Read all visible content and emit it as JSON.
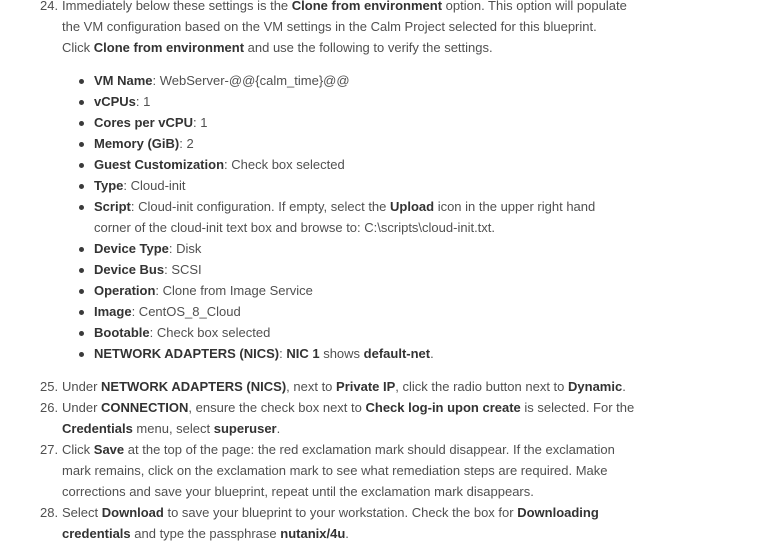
{
  "steps": [
    {
      "num": "24.",
      "lines": [
        [
          {
            "t": "Immediately below these settings is the "
          },
          {
            "b": "Clone from environment"
          },
          {
            "t": " option. This option will populate"
          }
        ],
        [
          {
            "t": "the VM configuration based on the VM settings in the Calm Project selected for this blueprint."
          }
        ],
        [
          {
            "t": "Click "
          },
          {
            "b": "Clone from environment"
          },
          {
            "t": " and use the following to verify the settings."
          }
        ]
      ]
    },
    {
      "num": "25.",
      "lines": [
        [
          {
            "t": "Under "
          },
          {
            "b": "NETWORK ADAPTERS (NICS)"
          },
          {
            "t": ", next to "
          },
          {
            "b": "Private IP"
          },
          {
            "t": ", click the radio button next to "
          },
          {
            "b": "Dynamic"
          },
          {
            "t": "."
          }
        ]
      ]
    },
    {
      "num": "26.",
      "lines": [
        [
          {
            "t": "Under "
          },
          {
            "b": "CONNECTION"
          },
          {
            "t": ", ensure the check box next to "
          },
          {
            "b": "Check log-in upon create"
          },
          {
            "t": " is selected. For the"
          }
        ],
        [
          {
            "b": "Credentials"
          },
          {
            "t": " menu, select "
          },
          {
            "b": "superuser"
          },
          {
            "t": "."
          }
        ]
      ]
    },
    {
      "num": "27.",
      "lines": [
        [
          {
            "t": "Click "
          },
          {
            "b": "Save"
          },
          {
            "t": " at the top of the page: the red exclamation mark should disappear. If the exclamation"
          }
        ],
        [
          {
            "t": "mark remains, click on the exclamation mark to see what remediation steps are required. Make"
          }
        ],
        [
          {
            "t": "corrections and save your blueprint, repeat until the exclamation mark disappears."
          }
        ]
      ]
    },
    {
      "num": "28.",
      "lines": [
        [
          {
            "t": "Select "
          },
          {
            "b": "Download"
          },
          {
            "t": " to save your blueprint to your workstation. Check the box for "
          },
          {
            "b": "Downloading"
          }
        ],
        [
          {
            "b": "credentials"
          },
          {
            "t": " and type the passphrase "
          },
          {
            "b": "nutanix/4u"
          },
          {
            "t": "."
          }
        ]
      ]
    }
  ],
  "bullets": [
    {
      "lines": [
        [
          {
            "b": "VM Name"
          },
          {
            "t": ": WebServer-@@{calm_time}@@"
          }
        ]
      ]
    },
    {
      "lines": [
        [
          {
            "b": "vCPUs"
          },
          {
            "t": ": 1"
          }
        ]
      ]
    },
    {
      "lines": [
        [
          {
            "b": "Cores per vCPU"
          },
          {
            "t": ": 1"
          }
        ]
      ]
    },
    {
      "lines": [
        [
          {
            "b": "Memory (GiB)"
          },
          {
            "t": ": 2"
          }
        ]
      ]
    },
    {
      "lines": [
        [
          {
            "b": "Guest Customization"
          },
          {
            "t": ": Check box selected"
          }
        ]
      ]
    },
    {
      "lines": [
        [
          {
            "b": "Type"
          },
          {
            "t": ": Cloud-init"
          }
        ]
      ]
    },
    {
      "lines": [
        [
          {
            "b": "Script"
          },
          {
            "t": ": Cloud-init configuration. If empty, select the "
          },
          {
            "b": "Upload"
          },
          {
            "t": " icon in the upper right hand"
          }
        ],
        [
          {
            "t": "corner of the cloud-init text box and browse to: C:\\scripts\\cloud-init.txt."
          }
        ]
      ]
    },
    {
      "lines": [
        [
          {
            "b": "Device Type"
          },
          {
            "t": ": Disk"
          }
        ]
      ]
    },
    {
      "lines": [
        [
          {
            "b": "Device Bus"
          },
          {
            "t": ": SCSI"
          }
        ]
      ]
    },
    {
      "lines": [
        [
          {
            "b": "Operation"
          },
          {
            "t": ": Clone from Image Service"
          }
        ]
      ]
    },
    {
      "lines": [
        [
          {
            "b": "Image"
          },
          {
            "t": ": CentOS_8_Cloud"
          }
        ]
      ]
    },
    {
      "lines": [
        [
          {
            "b": "Bootable"
          },
          {
            "t": ": Check box selected"
          }
        ]
      ]
    },
    {
      "lines": [
        [
          {
            "b": "NETWORK ADAPTERS (NICS)"
          },
          {
            "t": ": "
          },
          {
            "b": "NIC 1"
          },
          {
            "t": " shows "
          },
          {
            "b": "default-net"
          },
          {
            "t": "."
          }
        ]
      ]
    }
  ]
}
